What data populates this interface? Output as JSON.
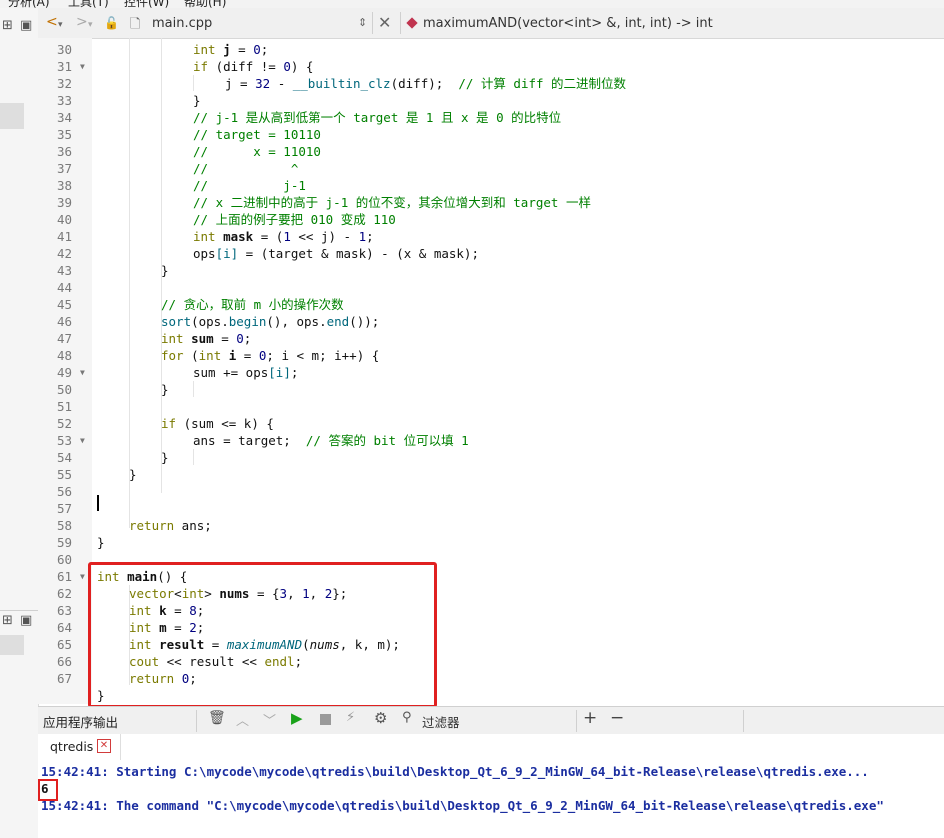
{
  "menubar": {
    "items": [
      "分析(A)",
      "工具(T)",
      "控件(W)",
      "帮助(H)"
    ]
  },
  "editor": {
    "file_name": "main.cpp",
    "function_signature": "maximumAND(vector<int> &, int, int) -> int",
    "line_numbers": [
      "30",
      "31",
      "32",
      "33",
      "34",
      "35",
      "36",
      "37",
      "38",
      "39",
      "40",
      "41",
      "42",
      "43",
      "44",
      "45",
      "46",
      "47",
      "48",
      "49",
      "50",
      "51",
      "52",
      "53",
      "54",
      "55",
      "56",
      "57",
      "58",
      "59",
      "60",
      "61",
      "62",
      "63",
      "64",
      "65",
      "66",
      "67"
    ],
    "code": {
      "l30": {
        "t1": "int",
        "t2": " ",
        "t3": "j",
        "t4": " = ",
        "t5": "0",
        "t6": ";"
      },
      "l31": {
        "t1": "if",
        "t2": " (diff != ",
        "t3": "0",
        "t4": ") {"
      },
      "l32": {
        "t1": "j",
        "t2": " = ",
        "t3": "32",
        "t4": " - ",
        "t5": "__builtin_clz",
        "t6": "(diff);  ",
        "t7": "// 计算 diff 的二进制位数"
      },
      "l33": {
        "t1": "}"
      },
      "l34": {
        "t1": "// j-1 是从高到低第一个 target 是 1 且 x 是 0 的比特位"
      },
      "l35": {
        "t1": "// target = 10110"
      },
      "l36": {
        "t1": "//      x = 11010"
      },
      "l37": {
        "t1": "//           ^"
      },
      "l38": {
        "t1": "//          j-1"
      },
      "l39": {
        "t1": "// x 二进制中的高于 j-1 的位不变，其余位增大到和 target 一样"
      },
      "l40": {
        "t1": "// 上面的例子要把 010 变成 110"
      },
      "l41": {
        "t1": "int",
        "t2": " ",
        "t3": "mask",
        "t4": " = (",
        "t5": "1",
        "t6": " << j) - ",
        "t7": "1",
        "t8": ";"
      },
      "l42": {
        "t1": "ops",
        "t2": "[i]",
        "t3": " = (target & mask) - (x & mask);"
      },
      "l43": {
        "t1": "}"
      },
      "l45": {
        "t1": "// 贪心，取前 m 小的操作次数"
      },
      "l46": {
        "t1": "sort",
        "t2": "(ops.",
        "t3": "begin",
        "t4": "(), ops.",
        "t5": "end",
        "t6": "());"
      },
      "l47": {
        "t1": "int",
        "t2": " ",
        "t3": "sum",
        "t4": " = ",
        "t5": "0",
        "t6": ";"
      },
      "l48": {
        "t1": "for",
        "t2": " (",
        "t3": "int",
        "t4": " ",
        "t5": "i",
        "t6": " = ",
        "t7": "0",
        "t8": "; i < m; i++) {"
      },
      "l49": {
        "t1": "sum += ops",
        "t2": "[i]",
        "t3": ";"
      },
      "l50": {
        "t1": "}"
      },
      "l52": {
        "t1": "if",
        "t2": " (sum <= k) {"
      },
      "l53": {
        "t1": "ans = target;  ",
        "t2": "// 答案的 bit 位可以填 1"
      },
      "l54": {
        "t1": "}"
      },
      "l55": {
        "t1": "}"
      },
      "l57": {
        "t1": "return",
        "t2": " ans;"
      },
      "l58": {
        "t1": "}"
      },
      "l60": {
        "t1": "int",
        "t2": " ",
        "t3": "main",
        "t4": "() {"
      },
      "l61": {
        "t1": "vector",
        "t2": "<",
        "t3": "int",
        "t4": "> ",
        "t5": "nums",
        "t6": " = {",
        "t7": "3",
        "t8": ", ",
        "t9": "1",
        "t10": ", ",
        "t11": "2",
        "t12": "};"
      },
      "l62": {
        "t1": "int",
        "t2": " ",
        "t3": "k",
        "t4": " = ",
        "t5": "8",
        "t6": ";"
      },
      "l63": {
        "t1": "int",
        "t2": " ",
        "t3": "m",
        "t4": " = ",
        "t5": "2",
        "t6": ";"
      },
      "l64": {
        "t1": "int",
        "t2": " ",
        "t3": "result",
        "t4": " = ",
        "t5": "maximumAND",
        "t6": "(",
        "t7": "nums",
        "t8": ", k, m);"
      },
      "l65": {
        "t1": "cout",
        "t2": " << result << ",
        "t3": "endl",
        "t4": ";"
      },
      "l66": {
        "t1": "return",
        "t2": " ",
        "t3": "0",
        "t4": ";"
      },
      "l67": {
        "t1": "}"
      }
    }
  },
  "output_pane": {
    "title": "应用程序输出",
    "filter_label": "过滤器",
    "tab_label": "qtredis",
    "lines": [
      "15:42:41: Starting C:\\mycode\\mycode\\qtredis\\build\\Desktop_Qt_6_9_2_MinGW_64_bit-Release\\release\\qtredis.exe...",
      "6",
      "15:42:41: The command \"C:\\mycode\\mycode\\qtredis\\build\\Desktop_Qt_6_9_2_MinGW_64_bit-Release\\release\\qtredis.exe\""
    ]
  },
  "colors": {
    "keyword": "#7a7a00",
    "comment": "#008000",
    "number": "#000080",
    "function": "#00677c",
    "output_text": "#1b2ea0",
    "highlight_border": "#e02020"
  }
}
